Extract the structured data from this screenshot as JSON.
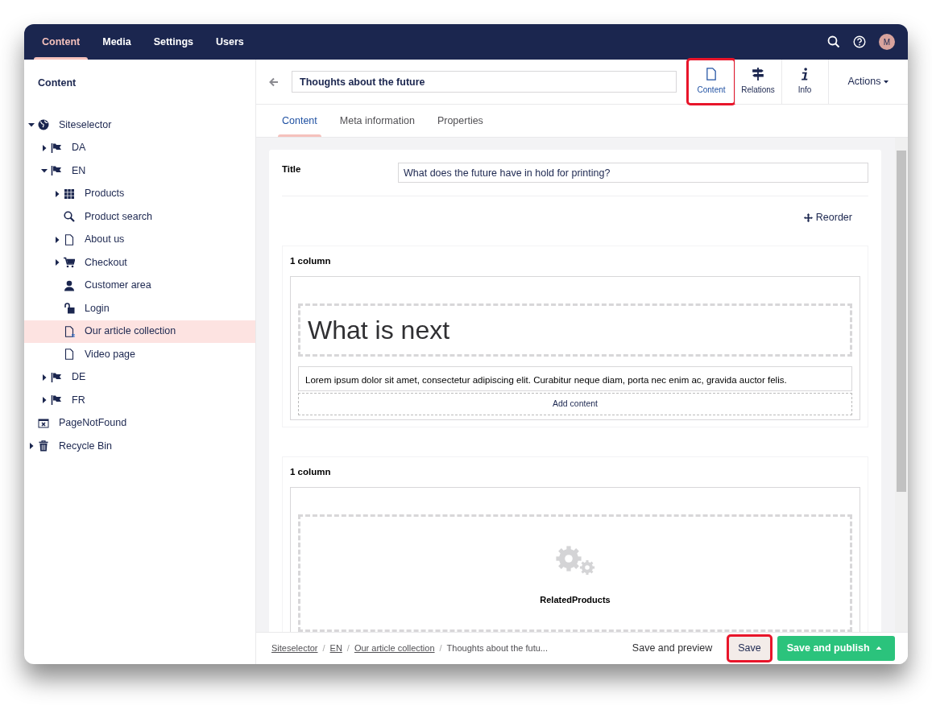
{
  "top_nav": {
    "sections": [
      {
        "label": "Content",
        "selected": true
      },
      {
        "label": "Media",
        "selected": false
      },
      {
        "label": "Settings",
        "selected": false
      },
      {
        "label": "Users",
        "selected": false
      }
    ],
    "avatar": "M"
  },
  "sidebar": {
    "title": "Content",
    "tree": [
      {
        "label": "Siteselector",
        "kind": "site",
        "expanded": true,
        "selected": false,
        "children": [
          {
            "label": "DA",
            "kind": "language",
            "expanded": false,
            "selected": false
          },
          {
            "label": "EN",
            "kind": "language",
            "expanded": true,
            "selected": false,
            "children": [
              {
                "label": "Products",
                "kind": "catalog",
                "expanded": false,
                "selected": false
              },
              {
                "label": "Product search",
                "kind": "search",
                "selected": false
              },
              {
                "label": "About us",
                "kind": "page",
                "expanded": false,
                "selected": false
              },
              {
                "label": "Checkout",
                "kind": "checkout",
                "expanded": false,
                "selected": false
              },
              {
                "label": "Customer area",
                "kind": "account",
                "selected": false
              },
              {
                "label": "Login",
                "kind": "login",
                "selected": false
              },
              {
                "label": "Our article collection",
                "kind": "collection",
                "selected": true
              },
              {
                "label": "Video page",
                "kind": "page",
                "selected": false
              }
            ]
          },
          {
            "label": "DE",
            "kind": "language",
            "expanded": false,
            "selected": false
          },
          {
            "label": "FR",
            "kind": "language",
            "expanded": false,
            "selected": false
          }
        ]
      },
      {
        "label": "PageNotFound",
        "kind": "notfound",
        "selected": false
      },
      {
        "label": "Recycle Bin",
        "kind": "recyclebin",
        "expanded": false,
        "selected": false
      }
    ]
  },
  "editor": {
    "name_field": {
      "value": "Thoughts about the future"
    },
    "apps": [
      {
        "label": "Content",
        "kind": "content",
        "selected": true,
        "highlighted": true
      },
      {
        "label": "Relations",
        "kind": "relations",
        "selected": false,
        "highlighted": false
      },
      {
        "label": "Info",
        "kind": "info",
        "selected": false,
        "highlighted": false
      }
    ],
    "actions": "Actions",
    "tabs": [
      {
        "label": "Content",
        "selected": true
      },
      {
        "label": "Meta information",
        "selected": false
      },
      {
        "label": "Properties",
        "selected": false
      }
    ],
    "title_property": {
      "label": "Title",
      "value": "What does the future have in hold for printing?"
    },
    "reorder": "Reorder",
    "grid_rows": [
      {
        "label": "1 column",
        "blocks": [
          {
            "kind": "headline",
            "text": "What is next"
          },
          {
            "kind": "richtext",
            "text": "Lorem ipsum dolor sit amet, consectetur adipiscing elit. Curabitur neque diam, porta nec enim ac, gravida auctor felis."
          },
          {
            "kind": "add",
            "text": "Add content"
          }
        ]
      },
      {
        "label": "1 column",
        "blocks": [
          {
            "kind": "macro",
            "text": "RelatedProducts"
          }
        ]
      }
    ]
  },
  "footer": {
    "breadcrumb": [
      {
        "label": "Siteselector",
        "link": true
      },
      {
        "label": "EN",
        "link": true
      },
      {
        "label": "Our article collection",
        "link": true
      },
      {
        "label": "Thoughts about the futu...",
        "link": false
      }
    ],
    "separators": [
      "/",
      "/",
      "/"
    ],
    "buttons": [
      {
        "label": "Save and preview",
        "kind": "link",
        "highlighted": false
      },
      {
        "label": "Save",
        "kind": "default",
        "highlighted": true
      },
      {
        "label": "Save and publish",
        "kind": "primary",
        "highlighted": false
      }
    ]
  }
}
